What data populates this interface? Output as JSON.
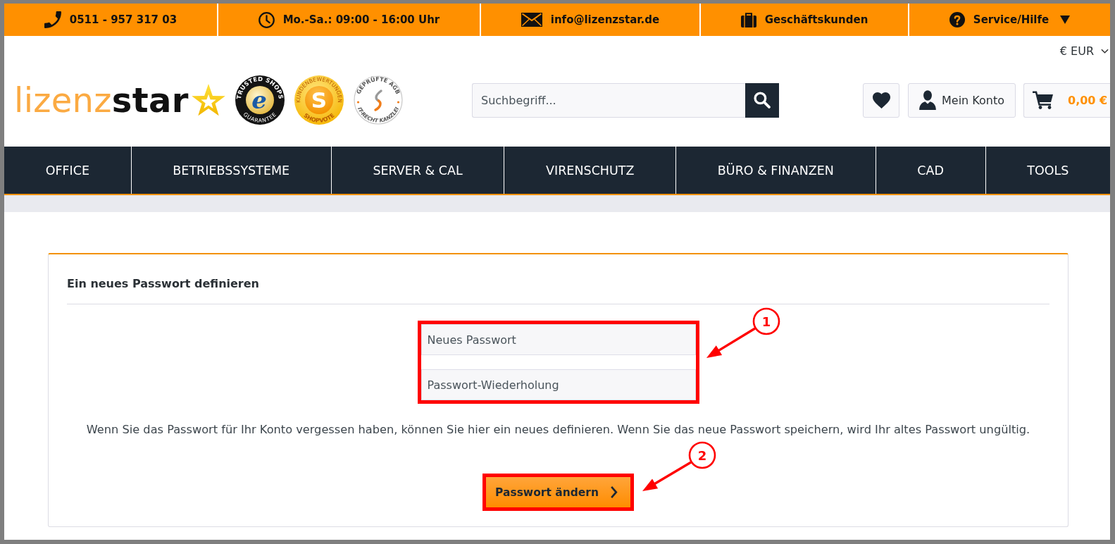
{
  "top_bar": [
    {
      "kind": "phone",
      "text": "0511 - 957 317 03"
    },
    {
      "kind": "clock",
      "text": "Mo.-Sa.: 09:00 - 16:00 Uhr"
    },
    {
      "kind": "mail",
      "text": "info@lizenzstar.de"
    },
    {
      "kind": "briefcase",
      "text": "Geschäftskunden"
    },
    {
      "kind": "help",
      "text": "Service/Hilfe",
      "dropdown": true
    }
  ],
  "currency": {
    "label": "€ EUR"
  },
  "logo": {
    "text": "lizenz**star**"
  },
  "seals": [
    {
      "kind": "guarantee",
      "top_text": "TRUSTED SHOPS",
      "center_text": "e",
      "bottom_text": "GUARANTEE"
    },
    {
      "kind": "rating",
      "top_text": "KUNDENBEWERTUNGEN",
      "center_text": "S",
      "bottom_text": "SHOPVOTE"
    },
    {
      "kind": "legal",
      "top_text": "GEPRÜFTE AGB",
      "bottom_text": "IT-RECHT KANZLEI"
    }
  ],
  "search": {
    "placeholder": "Suchbegriff..."
  },
  "header_actions": [
    {
      "kind": "wishlist"
    },
    {
      "kind": "account",
      "label": "Mein Konto"
    },
    {
      "kind": "cart",
      "label": "0,00 €"
    }
  ],
  "nav": [
    {
      "label": "OFFICE"
    },
    {
      "label": "BETRIEBSSYSTEME"
    },
    {
      "label": "SERVER & CAL"
    },
    {
      "label": "VIRENSCHUTZ"
    },
    {
      "label": "BÜRO & FINANZEN"
    },
    {
      "label": "CAD"
    },
    {
      "label": "TOOLS"
    }
  ],
  "card": {
    "title": "Ein neues Passwort definieren",
    "password_fields": {
      "callout": "1",
      "fields": [
        {
          "placeholder": "Neues Passwort"
        },
        {
          "placeholder": "Passwort-Wiederholung"
        }
      ]
    },
    "text": "Wenn Sie das Passwort für Ihr Konto vergessen haben, können Sie hier ein neues definieren. Wenn Sie das neue Passwort speichern, wird Ihr altes Passwort ungültig.",
    "submit": {
      "label": "Passwort ändern",
      "callout": "2"
    }
  }
}
